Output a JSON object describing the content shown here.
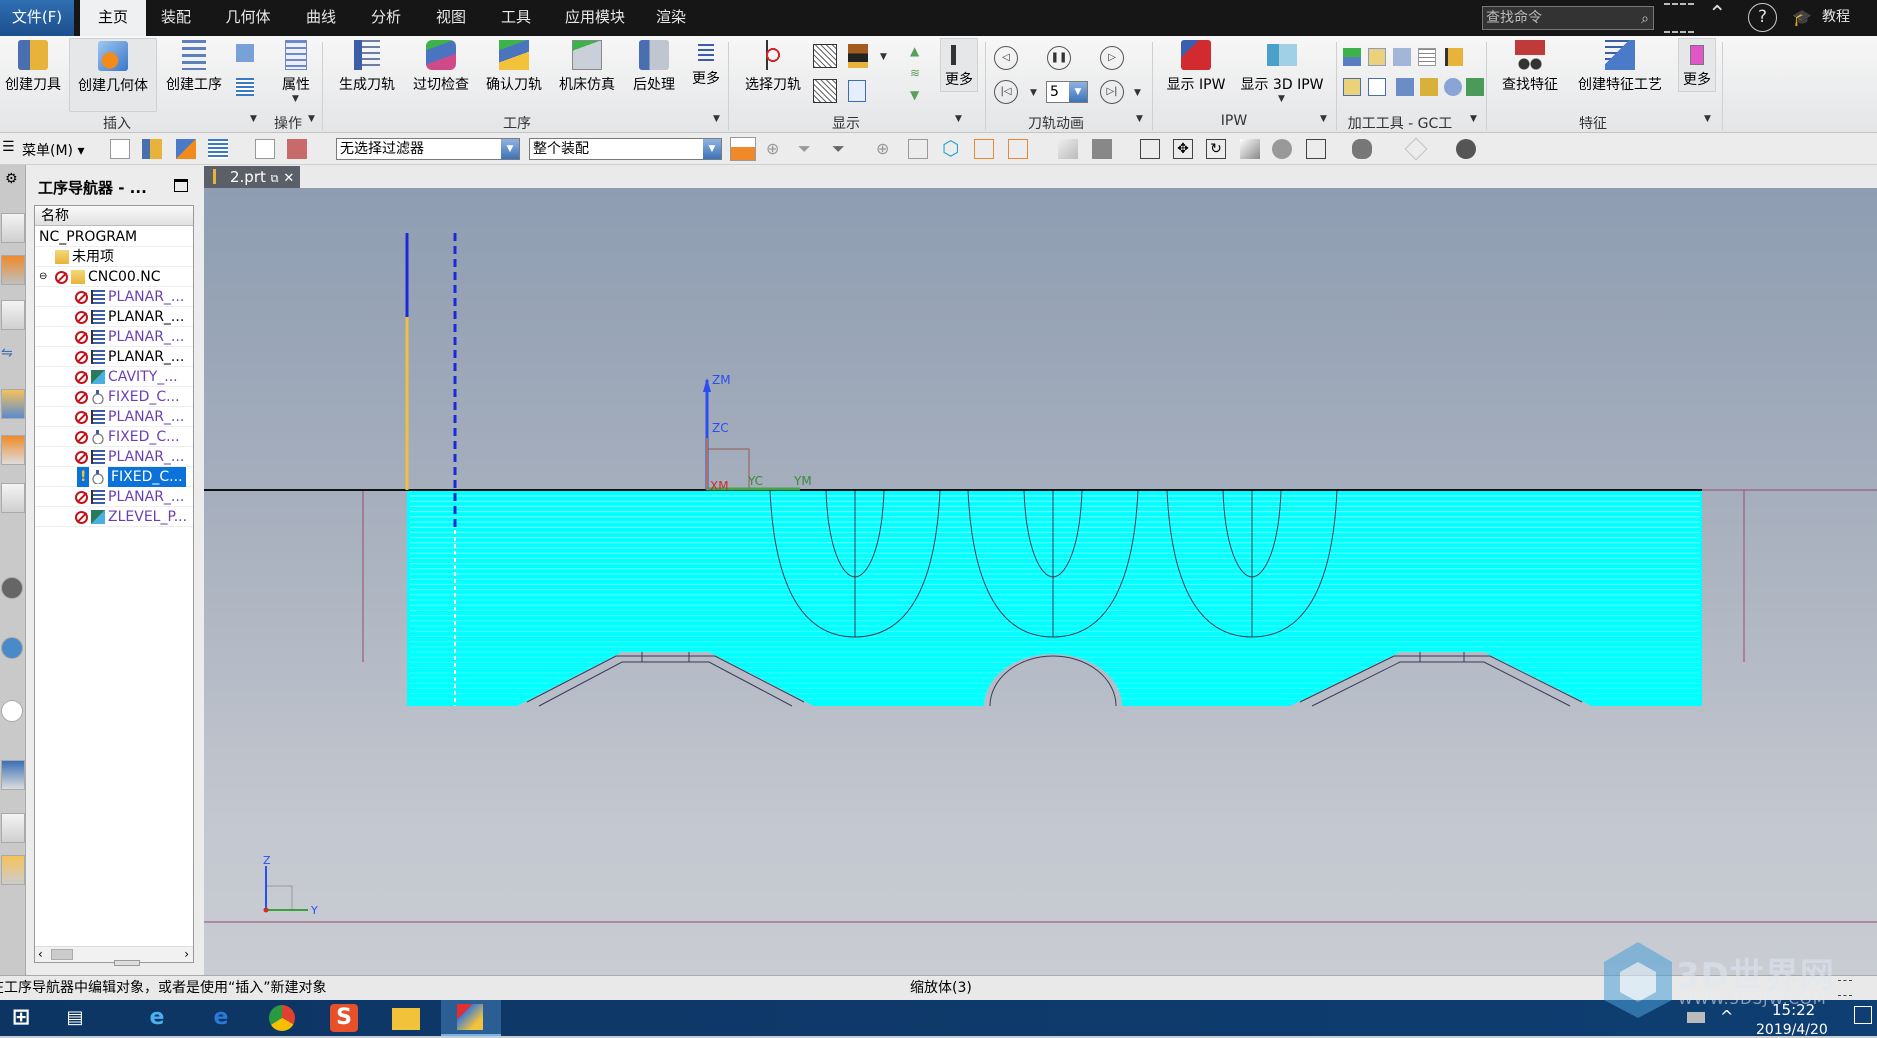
{
  "menubar": {
    "file": "文件(F)",
    "tabs": [
      "主页",
      "装配",
      "几何体",
      "曲线",
      "分析",
      "视图",
      "工具",
      "应用模块",
      "渲染"
    ],
    "active_tab": "主页",
    "search_placeholder": "查找命令",
    "tutorial": "教程"
  },
  "ribbon": {
    "groups": {
      "insert": {
        "label": "插入",
        "buttons": [
          "创建刀具",
          "创建几何体",
          "创建工序"
        ]
      },
      "operate": {
        "label": "操作",
        "buttons": [
          "属性"
        ]
      },
      "operation": {
        "label": "工序",
        "buttons": [
          "生成刀轨",
          "过切检查",
          "确认刀轨",
          "机床仿真",
          "后处理",
          "更多"
        ]
      },
      "display": {
        "label": "显示",
        "buttons": [
          "选择刀轨",
          "更多"
        ]
      },
      "animation": {
        "label": "刀轨动画",
        "speed": "5"
      },
      "ipw": {
        "label": "IPW",
        "buttons": [
          "显示 IPW",
          "显示 3D IPW"
        ]
      },
      "gc": {
        "label": "加工工具 - GC工"
      },
      "feature": {
        "label": "特征",
        "buttons": [
          "查找特征",
          "创建特征工艺",
          "更多"
        ]
      }
    }
  },
  "toolbar": {
    "menu": "菜单(M)",
    "filter": "无选择过滤器",
    "scope": "整个装配"
  },
  "document_tab": "2.prt",
  "navigator": {
    "title": "工序导航器 - ...",
    "column": "名称",
    "items": [
      {
        "name": "NC_PROGRAM",
        "level": 0,
        "color": "#000000",
        "type": "root"
      },
      {
        "name": "未用项",
        "level": 1,
        "color": "#000000",
        "type": "folder"
      },
      {
        "name": "CNC00.NC",
        "level": 1,
        "color": "#000000",
        "type": "program"
      },
      {
        "name": "PLANAR_...",
        "level": 2,
        "color": "#6a3fb5",
        "type": "planar"
      },
      {
        "name": "PLANAR_...",
        "level": 2,
        "color": "#000000",
        "type": "planar"
      },
      {
        "name": "PLANAR_...",
        "level": 2,
        "color": "#6a3fb5",
        "type": "planar"
      },
      {
        "name": "PLANAR_...",
        "level": 2,
        "color": "#000000",
        "type": "planar"
      },
      {
        "name": "CAVITY_...",
        "level": 2,
        "color": "#6a3fb5",
        "type": "cavity"
      },
      {
        "name": "FIXED_C...",
        "level": 2,
        "color": "#6a3fb5",
        "type": "fixed"
      },
      {
        "name": "PLANAR_...",
        "level": 2,
        "color": "#6a3fb5",
        "type": "planar"
      },
      {
        "name": "FIXED_C...",
        "level": 2,
        "color": "#6a3fb5",
        "type": "fixed"
      },
      {
        "name": "PLANAR_...",
        "level": 2,
        "color": "#6a3fb5",
        "type": "planar"
      },
      {
        "name": "FIXED_C...",
        "level": 2,
        "color": "#ffffff",
        "type": "fixed",
        "selected": true,
        "status": "warning"
      },
      {
        "name": "PLANAR_...",
        "level": 2,
        "color": "#6a3fb5",
        "type": "planar"
      },
      {
        "name": "ZLEVEL_P...",
        "level": 2,
        "color": "#6a3fb5",
        "type": "cavity"
      }
    ]
  },
  "viewport": {
    "axes": {
      "zm": "ZM",
      "zc": "ZC",
      "xm": "XM",
      "yc": "YC",
      "ym": "YM"
    },
    "mini_triad": {
      "z": "Z",
      "y": "Y"
    },
    "colors": {
      "toolpath": "#00ffff",
      "background_top": "#8e9db2",
      "background_bottom": "#c9ccd3"
    }
  },
  "statusbar": {
    "message": "在工序导航器中编辑对象，或者是使用“插入”新建对象",
    "center": "缩放体(3)"
  },
  "taskbar": {
    "time": "15:22",
    "date": "2019/4/20"
  },
  "watermark": {
    "brand": "3D世界网",
    "url": "WWW.3DSJW.COM"
  }
}
